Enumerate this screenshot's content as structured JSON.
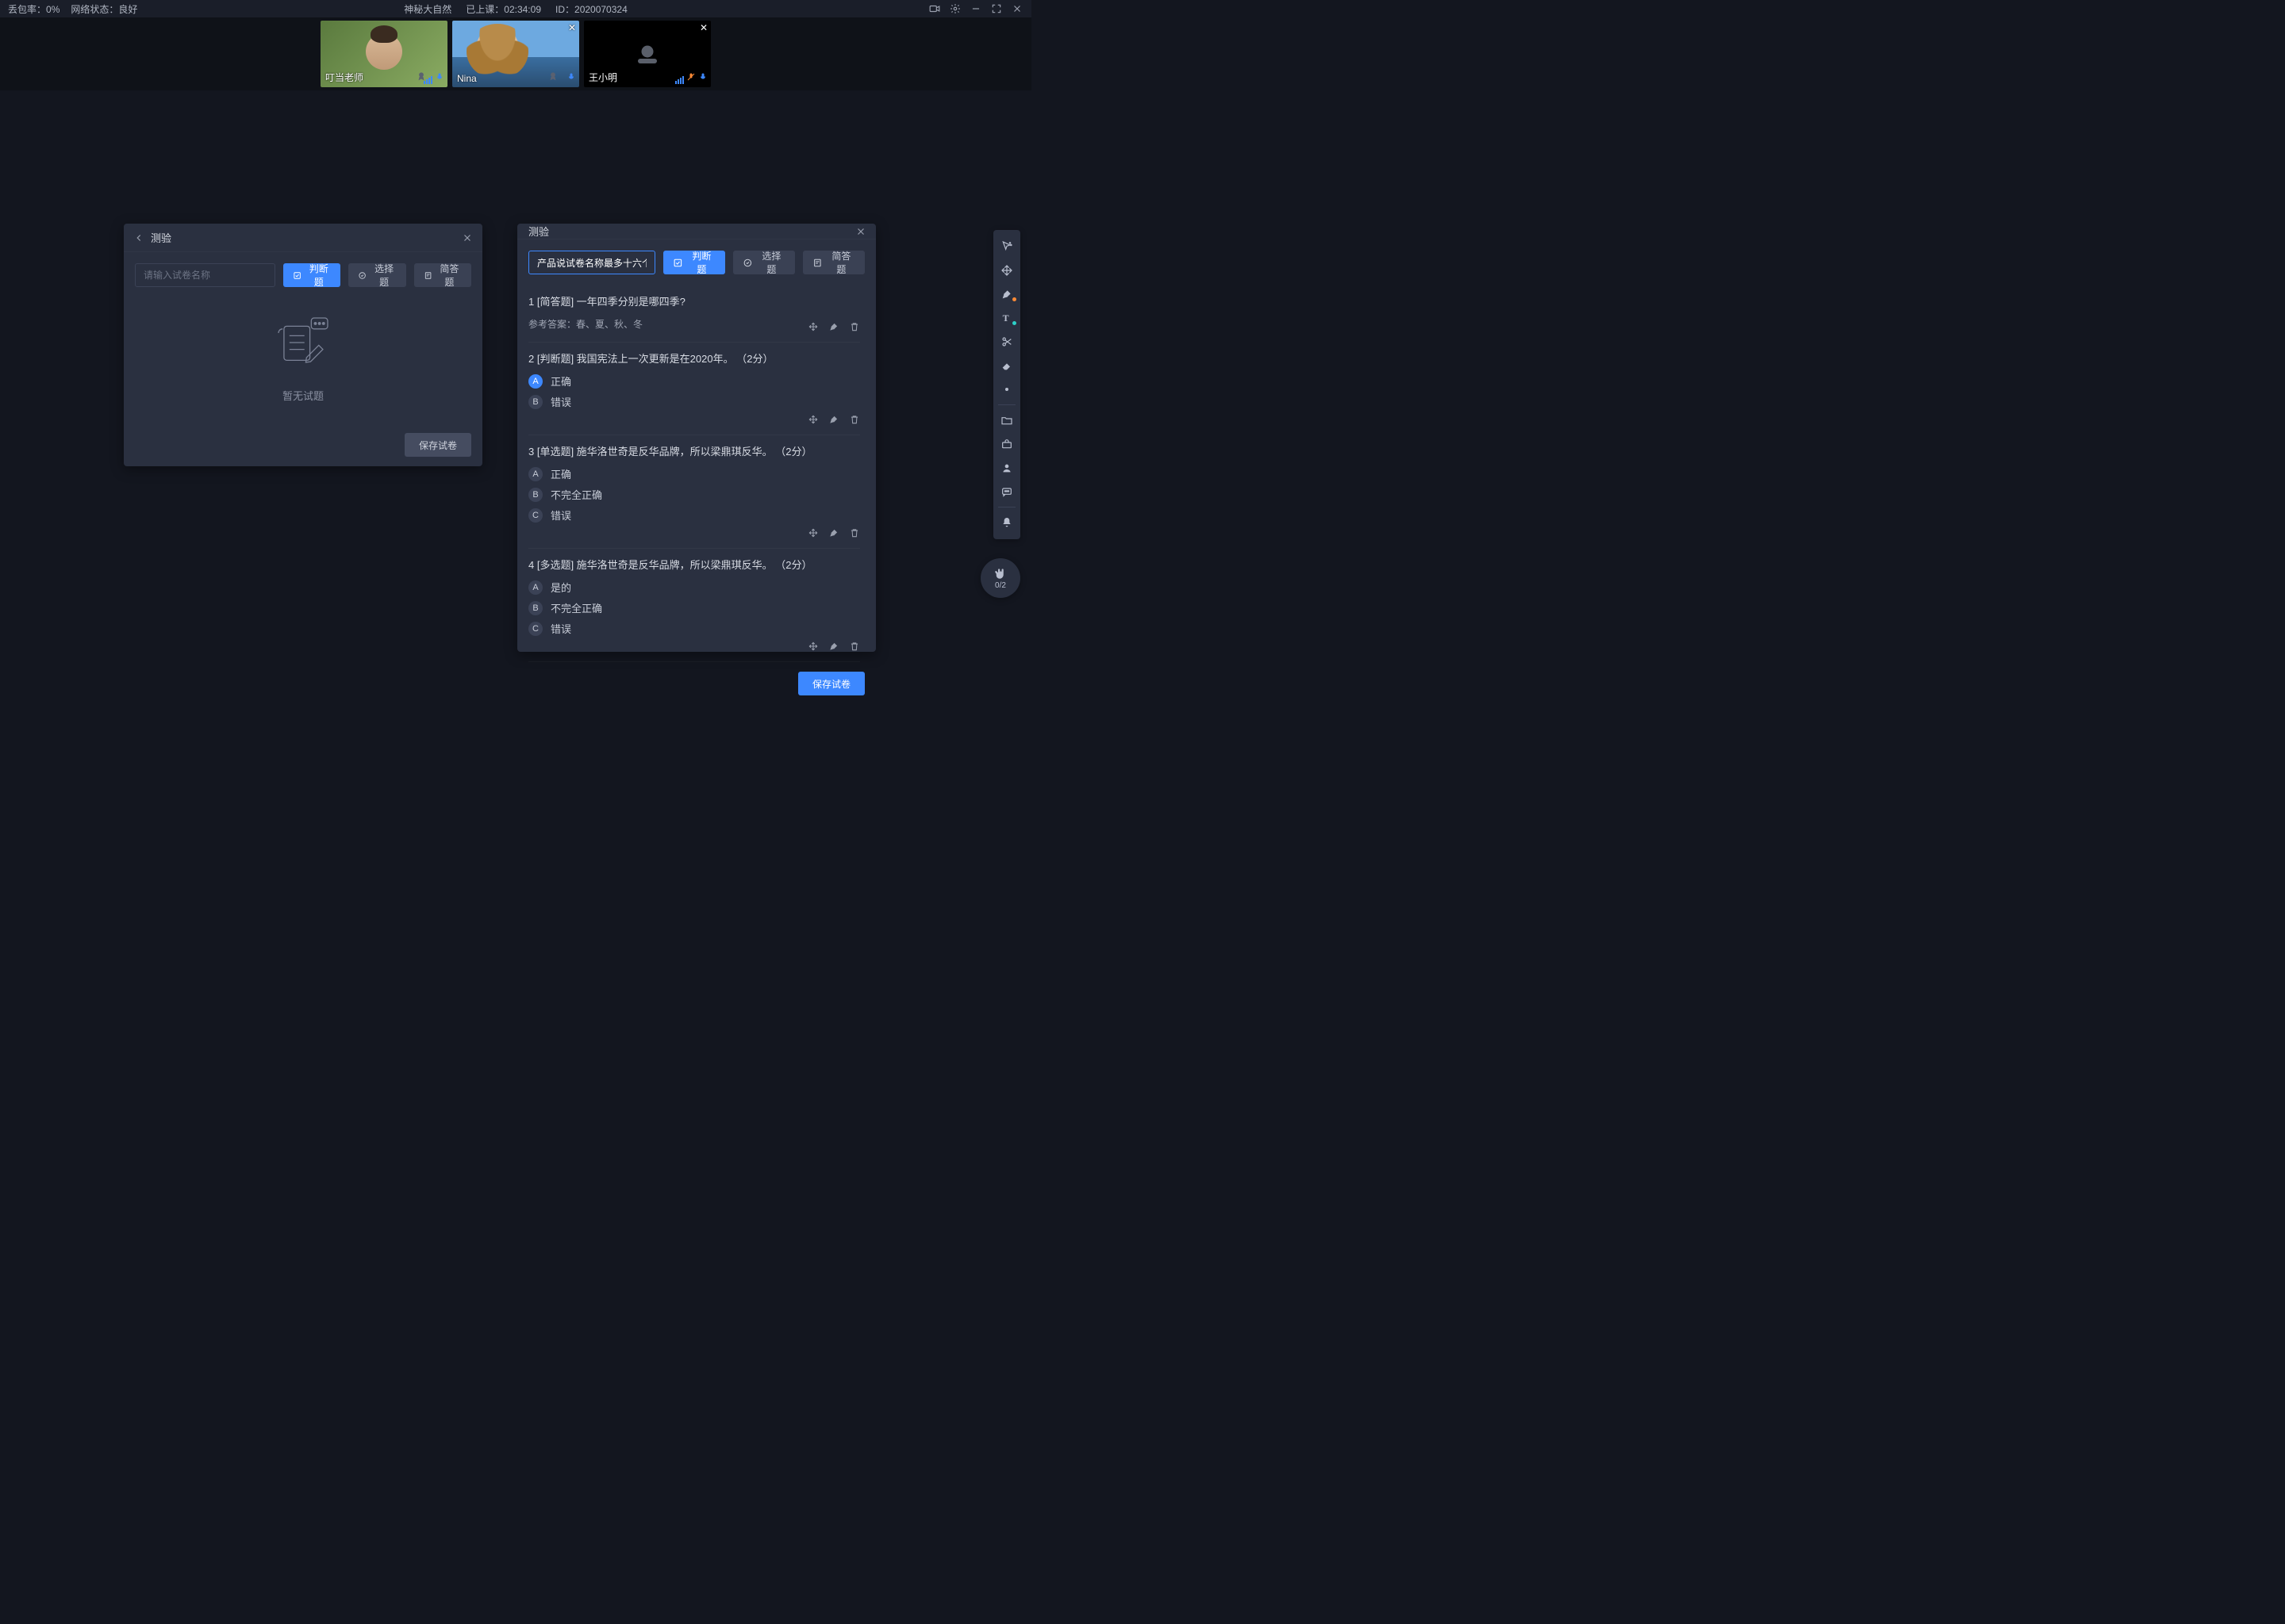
{
  "topbar": {
    "packet_loss_label": "丢包率：",
    "packet_loss_value": "0%",
    "network_label": "网络状态：",
    "network_value": "良好",
    "course_title": "神秘大自然",
    "elapsed_label": "已上课：",
    "elapsed_value": "02:34:09",
    "id_label": "ID：",
    "id_value": "2020070324"
  },
  "videos": [
    {
      "name": "叮当老师",
      "role": "teacher",
      "has_close": false,
      "mic": "on",
      "signal": true,
      "award": true
    },
    {
      "name": "Nina",
      "role": "student",
      "has_close": true,
      "mic": "on",
      "signal": false,
      "award": true
    },
    {
      "name": "王小明",
      "role": "student_camoff",
      "has_close": true,
      "mic": "on",
      "signal": true,
      "mic_muted_color": "#ff8b36",
      "award": false,
      "mic_extra": true
    }
  ],
  "panel_left": {
    "title": "测验",
    "placeholder": "请输入试卷名称",
    "btn_judge": "判断题",
    "btn_choice": "选择题",
    "btn_short": "简答题",
    "empty_text": "暂无试题",
    "save": "保存试卷"
  },
  "panel_right": {
    "title": "测验",
    "name_value": "产品说试卷名称最多十六个字",
    "btn_judge": "判断题",
    "btn_choice": "选择题",
    "btn_short": "简答题",
    "save": "保存试卷",
    "questions": [
      {
        "index": "1",
        "type_label": "[简答题]",
        "text": "一年四季分别是哪四季?",
        "answer_label": "参考答案：",
        "answer": "春、夏、秋、冬",
        "options": []
      },
      {
        "index": "2",
        "type_label": "[判断题]",
        "text": "我国宪法上一次更新是在2020年。 （2分）",
        "options": [
          {
            "letter": "A",
            "label": "正确",
            "selected": true
          },
          {
            "letter": "B",
            "label": "错误",
            "selected": false
          }
        ]
      },
      {
        "index": "3",
        "type_label": "[单选题]",
        "text": "施华洛世奇是反华品牌，所以梁鼎琪反华。 （2分）",
        "options": [
          {
            "letter": "A",
            "label": "正确",
            "selected": false
          },
          {
            "letter": "B",
            "label": "不完全正确",
            "selected": false
          },
          {
            "letter": "C",
            "label": "错误",
            "selected": false
          }
        ]
      },
      {
        "index": "4",
        "type_label": "[多选题]",
        "text": "施华洛世奇是反华品牌，所以梁鼎琪反华。 （2分）",
        "options": [
          {
            "letter": "A",
            "label": "是的",
            "selected": false
          },
          {
            "letter": "B",
            "label": "不完全正确",
            "selected": false
          },
          {
            "letter": "C",
            "label": "错误",
            "selected": false
          }
        ]
      }
    ]
  },
  "hands": {
    "count": "0/2"
  },
  "colors": {
    "accent": "#3d88ff",
    "orange": "#ff8b36",
    "teal": "#2dd0c8"
  }
}
